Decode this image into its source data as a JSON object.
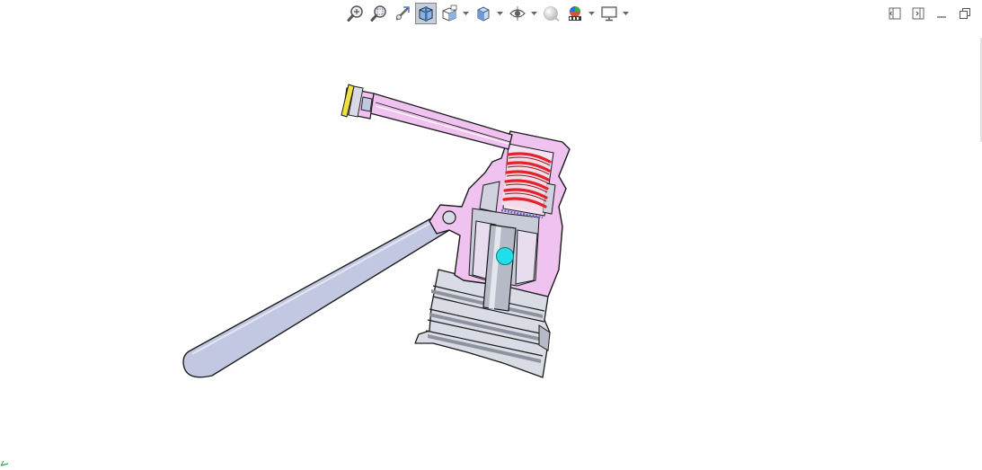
{
  "toolbar": {
    "buttons": [
      {
        "name": "zoom-to-fit",
        "icon": "magnifier-fit-icon",
        "has_dropdown": false
      },
      {
        "name": "zoom-to-area",
        "icon": "magnifier-area-icon",
        "has_dropdown": false
      },
      {
        "name": "previous-view",
        "icon": "previous-view-icon",
        "has_dropdown": false
      },
      {
        "name": "section-view",
        "icon": "section-view-icon",
        "has_dropdown": false,
        "active": true
      },
      {
        "name": "view-orientation",
        "icon": "view-orientation-icon",
        "has_dropdown": true
      },
      {
        "name": "display-style",
        "icon": "display-style-cube-icon",
        "has_dropdown": true
      },
      {
        "name": "hide-show-items",
        "icon": "eye-icon",
        "has_dropdown": true
      },
      {
        "name": "edit-appearance",
        "icon": "sphere-appearance-icon",
        "has_dropdown": false
      },
      {
        "name": "apply-scene",
        "icon": "scene-icon",
        "has_dropdown": true
      },
      {
        "name": "view-settings",
        "icon": "monitor-icon",
        "has_dropdown": true
      }
    ]
  },
  "window_controls": [
    {
      "name": "tile-left",
      "icon": "tile-left-icon"
    },
    {
      "name": "tile-right",
      "icon": "tile-right-icon"
    },
    {
      "name": "minimize",
      "icon": "minimize-icon"
    },
    {
      "name": "restore",
      "icon": "restore-icon"
    }
  ],
  "colors": {
    "housing_pink": "#efc2ef",
    "spring_red": "#e0242c",
    "lever_blue": "#c3c8e2",
    "cap_gray": "#b6bac6",
    "ball_cyan": "#1fe0e8",
    "nozzle_yellow": "#f0e040",
    "toolbar_active": "#c8cdd6"
  }
}
